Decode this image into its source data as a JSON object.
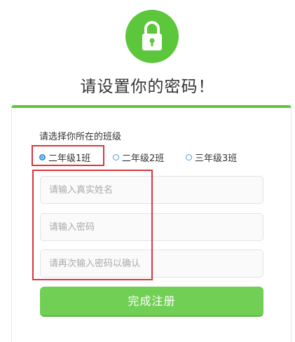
{
  "colors": {
    "accent_green": "#5cc73b",
    "button_green": "#72cf56",
    "highlight_red": "#d9363e",
    "radio_blue": "#2b8ad8"
  },
  "header": {
    "icon": "lock-icon",
    "title": "请设置你的密码！"
  },
  "form": {
    "class_label": "请选择你所在的班级",
    "class_options": [
      {
        "label": "二年级1班",
        "selected": true
      },
      {
        "label": "二年级2班",
        "selected": false
      },
      {
        "label": "三年级3班",
        "selected": false
      }
    ],
    "name_input": {
      "placeholder": "请输入真实姓名",
      "value": ""
    },
    "password_input": {
      "placeholder": "请输入密码",
      "value": ""
    },
    "confirm_input": {
      "placeholder": "请再次输入密码以确认",
      "value": ""
    },
    "submit_label": "完成注册"
  }
}
